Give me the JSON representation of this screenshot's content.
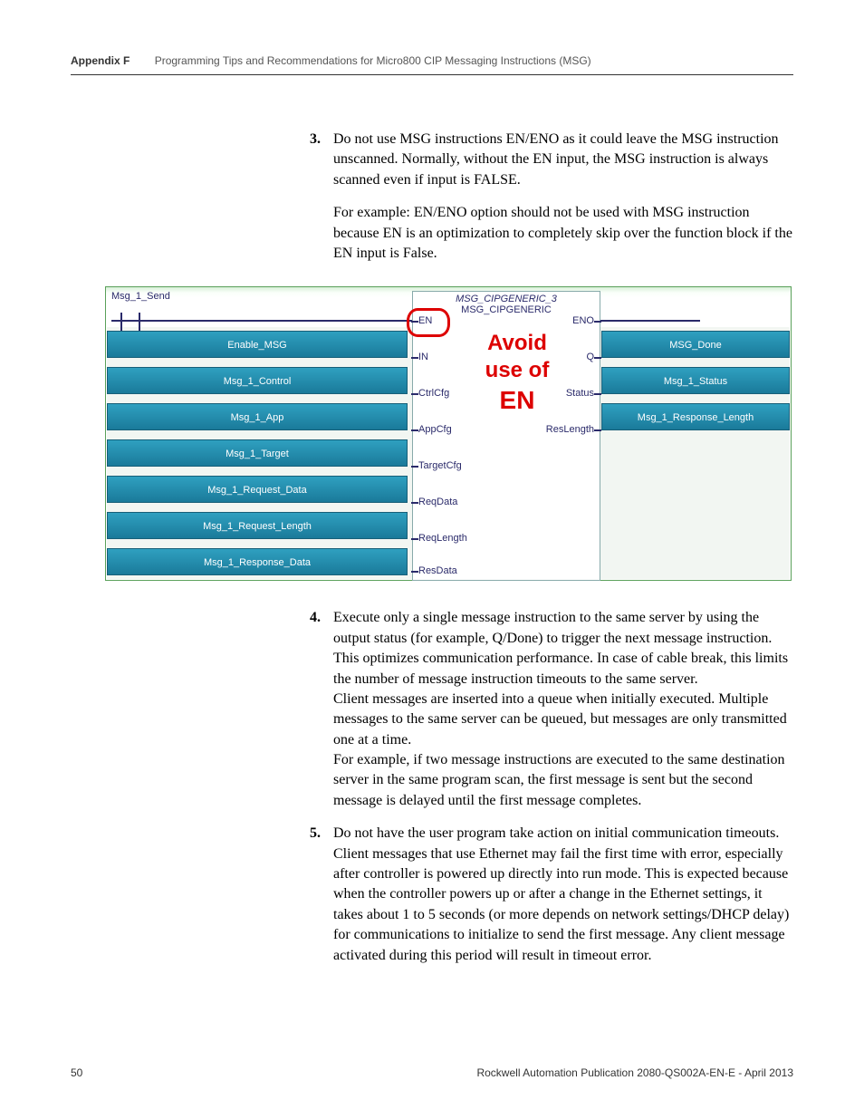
{
  "header": {
    "appendix": "Appendix F",
    "title": "Programming Tips and Recommendations for Micro800 CIP Messaging Instructions (MSG)"
  },
  "item3": {
    "num": "3.",
    "p1": "Do not use MSG instructions EN/ENO as it could leave the MSG instruction unscanned. Normally, without the EN input, the MSG instruction is always scanned even if input is FALSE.",
    "p2": "For example: EN/ENO option should not be used with MSG instruction because EN is an optimization to completely skip over the function block if the EN input is False."
  },
  "diagram": {
    "rung_label": "Msg_1_Send",
    "fb_name_instance": "MSG_CIPGENERIC_3",
    "fb_name_type": "MSG_CIPGENERIC",
    "avoid_line1": "Avoid",
    "avoid_line2": "use of",
    "avoid_line3": "EN",
    "left_pins": [
      "EN",
      "IN",
      "CtrlCfg",
      "AppCfg",
      "TargetCfg",
      "ReqData",
      "ReqLength",
      "ResData"
    ],
    "right_pins": [
      "ENO",
      "Q",
      "Status",
      "ResLength"
    ],
    "left_tags": [
      "Enable_MSG",
      "Msg_1_Control",
      "Msg_1_App",
      "Msg_1_Target",
      "Msg_1_Request_Data",
      "Msg_1_Request_Length",
      "Msg_1_Response_Data"
    ],
    "right_tags": [
      "MSG_Done",
      "Msg_1_Status",
      "Msg_1_Response_Length"
    ]
  },
  "item4": {
    "num": "4.",
    "p1": "Execute only a single message instruction to the same server by using the output status (for example, Q/Done) to trigger the next message instruction. This optimizes communication performance. In case of cable break, this limits the number of message instruction timeouts to the same server.",
    "p2": "Client messages are inserted into a queue when initially executed. Multiple messages to the same server can be queued, but messages are only transmitted one at a time.",
    "p3": "For example, if two message instructions are executed to the same destination server in the same program scan, the first message is sent but the second message is delayed until the first message completes."
  },
  "item5": {
    "num": "5.",
    "p1": "Do not have the user program take action on initial communication timeouts. Client messages that use Ethernet may fail the first time with error, especially after controller is powered up directly into run mode. This is expected because when the controller powers up or after a change in the Ethernet settings, it takes about 1 to 5 seconds (or more depends on network settings/DHCP delay) for communications to initialize to send the first message. Any client message activated during this period will result in timeout error."
  },
  "footer": {
    "page": "50",
    "pub": "Rockwell Automation Publication 2080-QS002A-EN-E - April 2013"
  }
}
